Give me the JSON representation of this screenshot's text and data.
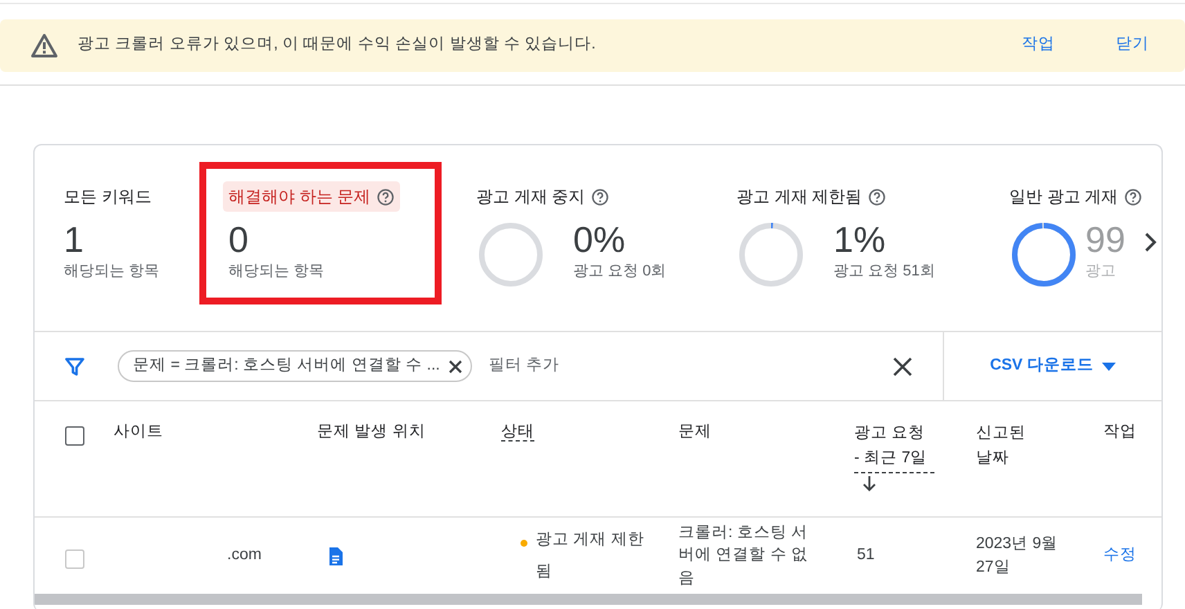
{
  "alert": {
    "message": "광고 크롤러 오류가 있으며, 이 때문에 수익 손실이 발생할 수 있습니다.",
    "actions": [
      "작업",
      "닫기"
    ]
  },
  "metrics": [
    {
      "kind": "count",
      "label": "모든 키워드",
      "value": "1",
      "sub": "해당되는 항목",
      "selected": false,
      "help": false
    },
    {
      "kind": "count",
      "label": "해결해야 하는 문제",
      "value": "0",
      "sub": "해당되는 항목",
      "selected": true,
      "help": true
    },
    {
      "kind": "donut",
      "label": "광고 게재 중지",
      "value": "0%",
      "sub": "광고 요청 0회",
      "level": 0,
      "help": true,
      "faded": false
    },
    {
      "kind": "donut",
      "label": "광고 게재 제한됨",
      "value": "1%",
      "sub": "광고 요청 51회",
      "level": 0.01,
      "help": true,
      "faded": false
    },
    {
      "kind": "donut",
      "label": "일반 광고 게재",
      "value": "99",
      "sub": "광고",
      "level": 0.99,
      "help": true,
      "faded": true
    }
  ],
  "filter": {
    "chip": "문제 = 크롤러: 호스팅 서버에 연결할 수 ...",
    "placeholder": "필터 추가",
    "download": "CSV 다운로드"
  },
  "table": {
    "all_checked": false,
    "columns": [
      {
        "label": "사이트",
        "sortable": false
      },
      {
        "label": "문제 발생 위치",
        "sortable": false
      },
      {
        "label": "상태",
        "sortable": true
      },
      {
        "label": "문제",
        "sortable": false
      },
      {
        "label": "광고 요청 - 최근 7일",
        "sortable": true,
        "sorted": true
      },
      {
        "label": "신고된 날짜",
        "sortable": false
      },
      {
        "label": "작업",
        "sortable": false
      }
    ],
    "rows": [
      {
        "checked": false,
        "site": ".com",
        "status": "광고 게재 제한됨",
        "color": "#f9ab00",
        "issue": "크롤러: 호스팅 서버에 연결할 수 없음",
        "requests": "51",
        "date": "2023년 9월 27일",
        "action": "수정"
      }
    ]
  }
}
